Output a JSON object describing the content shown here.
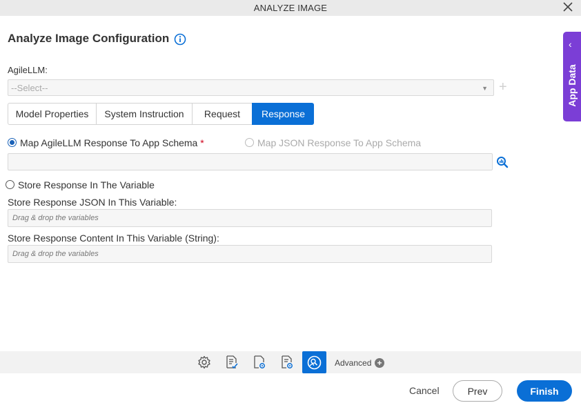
{
  "window": {
    "title": "ANALYZE IMAGE"
  },
  "heading": "Analyze Image Configuration",
  "agilellm": {
    "label": "AgileLLM:",
    "selected": "--Select--"
  },
  "tabs": [
    {
      "label": "Model Properties",
      "active": false
    },
    {
      "label": "System Instruction",
      "active": false
    },
    {
      "label": "Request",
      "active": false
    },
    {
      "label": "Response",
      "active": true
    }
  ],
  "response": {
    "map_agilellm_label": "Map AgileLLM Response To App Schema",
    "required_mark": "*",
    "map_json_label": "Map JSON Response To App Schema",
    "store_response_label": "Store Response In The Variable",
    "json_variable_label": "Store Response JSON In This Variable:",
    "json_variable_placeholder": "Drag & drop the variables",
    "content_variable_label": "Store Response Content In This Variable (String):",
    "content_variable_placeholder": "Drag & drop the variables"
  },
  "side_panel": {
    "label": "App Data"
  },
  "toolbar": {
    "advanced_label": "Advanced"
  },
  "footer": {
    "cancel": "Cancel",
    "prev": "Prev",
    "finish": "Finish"
  },
  "colors": {
    "primary": "#0a6fd6",
    "app_data_tab": "#7b3ed6",
    "required": "#d0021b"
  }
}
